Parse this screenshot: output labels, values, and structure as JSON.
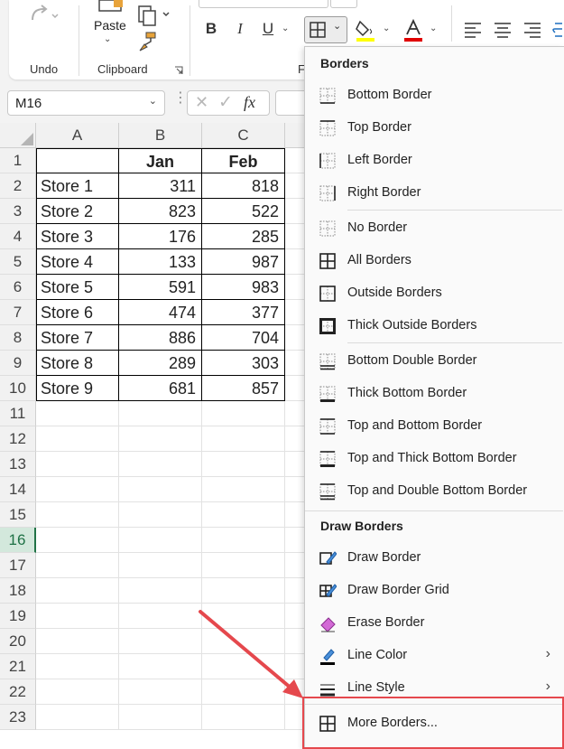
{
  "ribbon": {
    "undo_label": "Undo",
    "clipboard_label": "Clipboard",
    "paste_label": "Paste",
    "font_group_label_partial": "F",
    "bold_label": "B",
    "italic_label": "I",
    "underline_label": "U",
    "fill_color": "#ffff00",
    "font_color": "#e00000"
  },
  "formula_bar": {
    "name_box": "M16",
    "fx_label": "fx",
    "cancel_symbol": "✕",
    "enter_symbol": "✓"
  },
  "grid": {
    "columns": [
      "A",
      "B",
      "C"
    ],
    "rows": [
      "1",
      "2",
      "3",
      "4",
      "5",
      "6",
      "7",
      "8",
      "9",
      "10",
      "11",
      "12",
      "13",
      "14",
      "15",
      "16",
      "17",
      "18",
      "19",
      "20",
      "21",
      "22",
      "23"
    ],
    "selected_row": "16",
    "header_row": [
      "",
      "Jan",
      "Feb"
    ],
    "data": [
      [
        "Store 1",
        "311",
        "818"
      ],
      [
        "Store 2",
        "823",
        "522"
      ],
      [
        "Store 3",
        "176",
        "285"
      ],
      [
        "Store 4",
        "133",
        "987"
      ],
      [
        "Store 5",
        "591",
        "983"
      ],
      [
        "Store 6",
        "474",
        "377"
      ],
      [
        "Store 7",
        "886",
        "704"
      ],
      [
        "Store 8",
        "289",
        "303"
      ],
      [
        "Store 9",
        "681",
        "857"
      ]
    ]
  },
  "menu": {
    "section_borders": "Borders",
    "section_draw": "Draw Borders",
    "items": [
      {
        "label": "Bottom Border",
        "icon": "bottom-border-icon"
      },
      {
        "label": "Top Border",
        "icon": "top-border-icon"
      },
      {
        "label": "Left Border",
        "icon": "left-border-icon"
      },
      {
        "label": "Right Border",
        "icon": "right-border-icon"
      },
      {
        "label": "No Border",
        "icon": "no-border-icon"
      },
      {
        "label": "All Borders",
        "icon": "all-borders-icon"
      },
      {
        "label": "Outside Borders",
        "icon": "outside-borders-icon"
      },
      {
        "label": "Thick Outside Borders",
        "icon": "thick-outside-borders-icon"
      },
      {
        "label": "Bottom Double Border",
        "icon": "bottom-double-border-icon"
      },
      {
        "label": "Thick Bottom Border",
        "icon": "thick-bottom-border-icon"
      },
      {
        "label": "Top and Bottom Border",
        "icon": "top-bottom-border-icon"
      },
      {
        "label": "Top and Thick Bottom Border",
        "icon": "top-thick-bottom-border-icon"
      },
      {
        "label": "Top and Double Bottom Border",
        "icon": "top-double-bottom-border-icon"
      }
    ],
    "draw_items": [
      {
        "label": "Draw Border",
        "icon": "draw-border-icon"
      },
      {
        "label": "Draw Border Grid",
        "icon": "draw-border-grid-icon"
      },
      {
        "label": "Erase Border",
        "icon": "eraser-icon"
      },
      {
        "label": "Line Color",
        "icon": "line-color-icon"
      },
      {
        "label": "Line Style",
        "icon": "line-style-icon"
      }
    ],
    "more_borders": "More Borders...",
    "submenu_arrow": "›"
  },
  "annotation": {
    "arrow_color": "#e5484d",
    "highlight_color": "#e5484d"
  }
}
